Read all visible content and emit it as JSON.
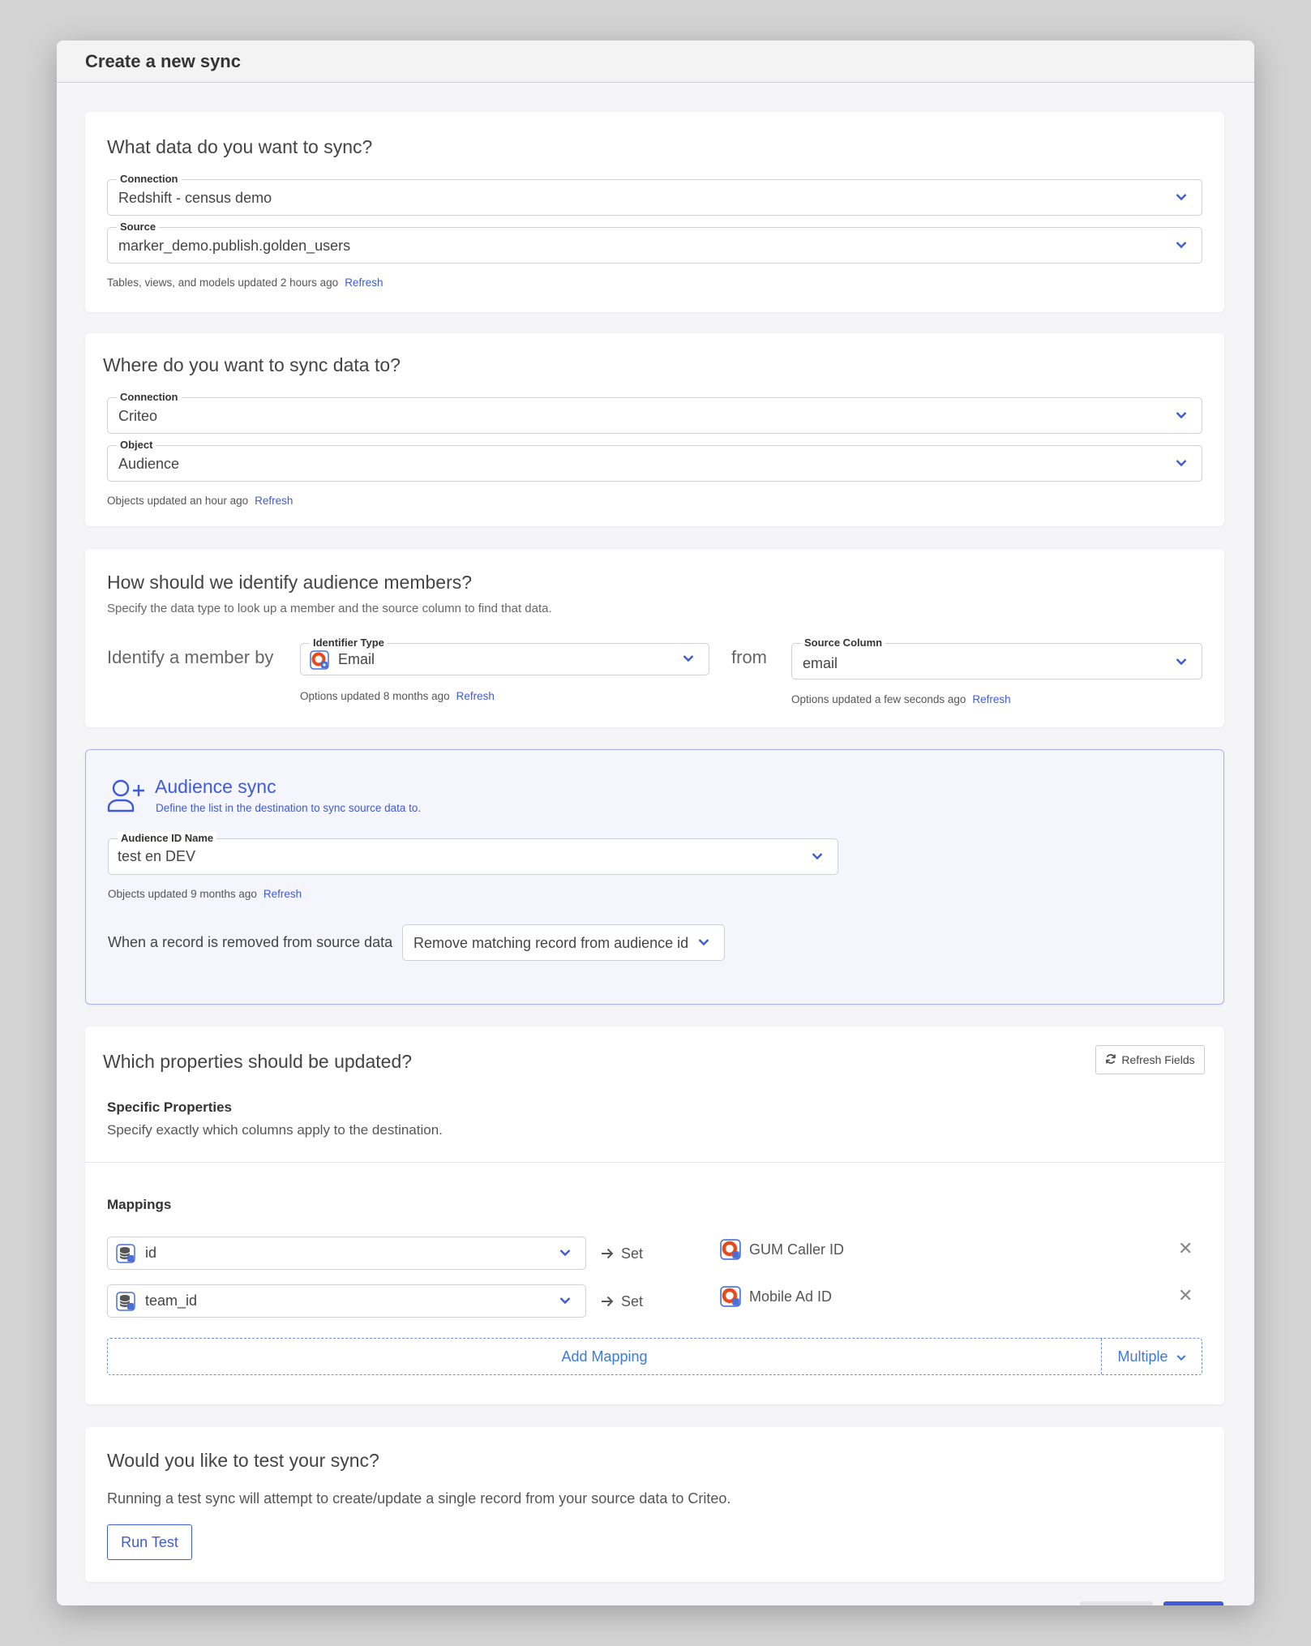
{
  "modal": {
    "title": "Create a new sync"
  },
  "source_card": {
    "title": "What data do you want to sync?",
    "connection_label": "Connection",
    "connection_value": "Redshift - census demo",
    "source_label": "Source",
    "source_value": "marker_demo.publish.golden_users",
    "hint": "Tables, views, and models updated 2 hours ago",
    "refresh": "Refresh"
  },
  "dest_card": {
    "title": "Where do you want to sync data to?",
    "connection_label": "Connection",
    "connection_value": "Criteo",
    "object_label": "Object",
    "object_value": "Audience",
    "hint": "Objects updated an hour ago",
    "refresh": "Refresh"
  },
  "identify_card": {
    "title": "How should we identify audience members?",
    "subtitle": "Specify the data type to look up a member and the source column to find that data.",
    "lead": "Identify a member by",
    "identifier_label": "Identifier Type",
    "identifier_value": "Email",
    "identifier_hint": "Options updated 8 months ago",
    "from": "from",
    "column_label": "Source Column",
    "column_value": "email",
    "column_hint": "Options updated a few seconds ago",
    "refresh": "Refresh"
  },
  "audience_card": {
    "title": "Audience sync",
    "subtitle": "Define the list in the destination to sync source data to.",
    "audience_label": "Audience ID Name",
    "audience_value": "test en DEV",
    "hint": "Objects updated 9 months ago",
    "refresh": "Refresh",
    "removed_label": "When a record is removed from source data",
    "removed_value": "Remove matching record from audience id"
  },
  "props_card": {
    "title": "Which properties should be updated?",
    "refresh_fields": "Refresh Fields",
    "specific_title": "Specific Properties",
    "specific_sub": "Specify exactly which columns apply to the destination.",
    "mappings_title": "Mappings",
    "set_label": "Set",
    "mappings": [
      {
        "source": "id",
        "dest": "GUM Caller ID"
      },
      {
        "source": "team_id",
        "dest": "Mobile Ad ID"
      }
    ],
    "add_mapping": "Add Mapping",
    "multiple": "Multiple"
  },
  "test_card": {
    "title": "Would you like to test your sync?",
    "text": "Running a test sync will attempt to create/update a single record from your source data to Criteo.",
    "run_test": "Run Test"
  },
  "colors": {
    "accent": "#3f5bd6",
    "brand_icon": "#e8491d"
  }
}
